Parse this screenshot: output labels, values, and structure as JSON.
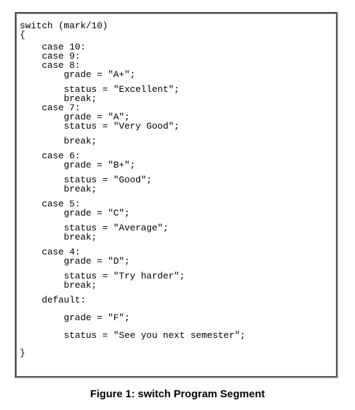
{
  "figure": {
    "caption": "Figure 1: switch Program Segment",
    "language": "C"
  },
  "code": {
    "lines": [
      {
        "text": "switch (mark/10)",
        "gap": 0
      },
      {
        "text": "{",
        "gap": 0
      },
      {
        "text": "    case 10:",
        "gap": 1
      },
      {
        "text": "    case 9:",
        "gap": 0
      },
      {
        "text": "    case 8:",
        "gap": 0
      },
      {
        "text": "        grade = \"A+\";",
        "gap": 0
      },
      {
        "text": "        status = \"Excellent\";",
        "gap": 2
      },
      {
        "text": "        break;",
        "gap": 0
      },
      {
        "text": "    case 7:",
        "gap": 0
      },
      {
        "text": "        grade = \"A\";",
        "gap": 0
      },
      {
        "text": "        status = \"Very Good\";",
        "gap": 0
      },
      {
        "text": "        break;",
        "gap": 2
      },
      {
        "text": "    case 6:",
        "gap": 2
      },
      {
        "text": "        grade = \"B+\";",
        "gap": 0
      },
      {
        "text": "        status = \"Good\";",
        "gap": 2
      },
      {
        "text": "        break;",
        "gap": 0
      },
      {
        "text": "    case 5:",
        "gap": 2
      },
      {
        "text": "        grade = \"C\";",
        "gap": 0
      },
      {
        "text": "        status = \"Average\";",
        "gap": 2
      },
      {
        "text": "        break;",
        "gap": 0
      },
      {
        "text": "    case 4:",
        "gap": 2
      },
      {
        "text": "        grade = \"D\";",
        "gap": 0
      },
      {
        "text": "        status = \"Try harder\";",
        "gap": 2
      },
      {
        "text": "        break;",
        "gap": 0
      },
      {
        "text": "    default:",
        "gap": 2
      },
      {
        "text": "        grade = \"F\";",
        "gap": 3
      },
      {
        "text": "        status = \"See you next semester\";",
        "gap": 3
      },
      {
        "text": "}",
        "gap": 3
      }
    ],
    "text": "switch (mark/10)\n{\n    case 10:\n    case 9:\n    case 8:\n        grade = \"A+\";\n\n        status = \"Excellent\";\n        break;\n    case 7:\n        grade = \"A\";\n        status = \"Very Good\";\n\n        break;\n\n    case 6:\n        grade = \"B+\";\n\n        status = \"Good\";\n        break;\n\n    case 5:\n        grade = \"C\";\n\n        status = \"Average\";\n        break;\n\n    case 4:\n        grade = \"D\";\n\n        status = \"Try harder\";\n        break;\n\n    default:\n\n        grade = \"F\";\n\n        status = \"See you next semester\";\n\n}",
    "keywords": [
      "switch",
      "case",
      "default",
      "break"
    ],
    "cases": [
      {
        "labels": [
          "case 10:",
          "case 9:",
          "case 8:"
        ],
        "grade": "A+",
        "status": "Excellent"
      },
      {
        "labels": [
          "case 7:"
        ],
        "grade": "A",
        "status": "Very Good"
      },
      {
        "labels": [
          "case 6:"
        ],
        "grade": "B+",
        "status": "Good"
      },
      {
        "labels": [
          "case 5:"
        ],
        "grade": "C",
        "status": "Average"
      },
      {
        "labels": [
          "case 4:"
        ],
        "grade": "D",
        "status": "Try harder"
      },
      {
        "labels": [
          "default:"
        ],
        "grade": "F",
        "status": "See you next semester"
      }
    ]
  }
}
